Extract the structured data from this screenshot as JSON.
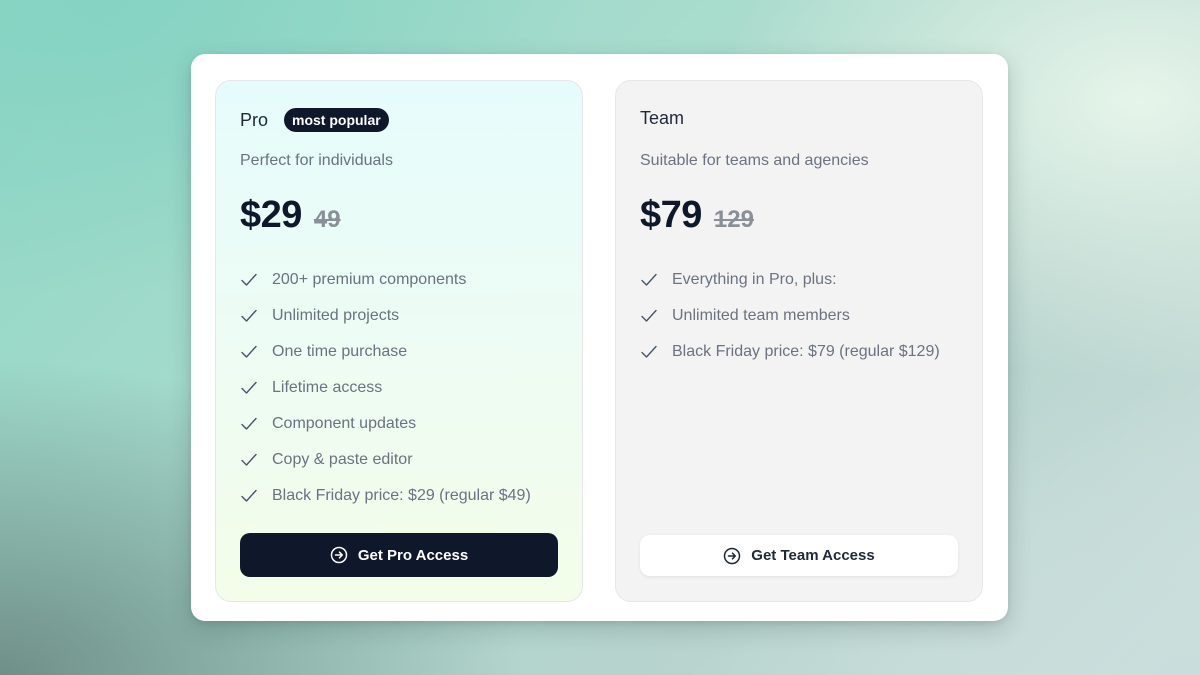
{
  "plans": [
    {
      "name": "Pro",
      "badge": "most popular",
      "description": "Perfect for individuals",
      "price": "$29",
      "old_price": "49",
      "features": [
        "200+ premium components",
        "Unlimited projects",
        "One time purchase",
        "Lifetime access",
        "Component updates",
        "Copy & paste editor",
        "Black Friday price: $29 (regular $49)"
      ],
      "cta": "Get Pro Access",
      "cta_icon": "arrow-right-circle-icon"
    },
    {
      "name": "Team",
      "description": "Suitable for teams and agencies",
      "price": "$79",
      "old_price": "129",
      "features": [
        "Everything in Pro, plus:",
        "Unlimited team members",
        "Black Friday price: $79 (regular $129)"
      ],
      "cta": "Get Team Access",
      "cta_icon": "arrow-right-circle-icon"
    }
  ],
  "colors": {
    "primary_dark": "#0f172a",
    "muted_text": "#6b7280",
    "check_color": "#475569"
  }
}
